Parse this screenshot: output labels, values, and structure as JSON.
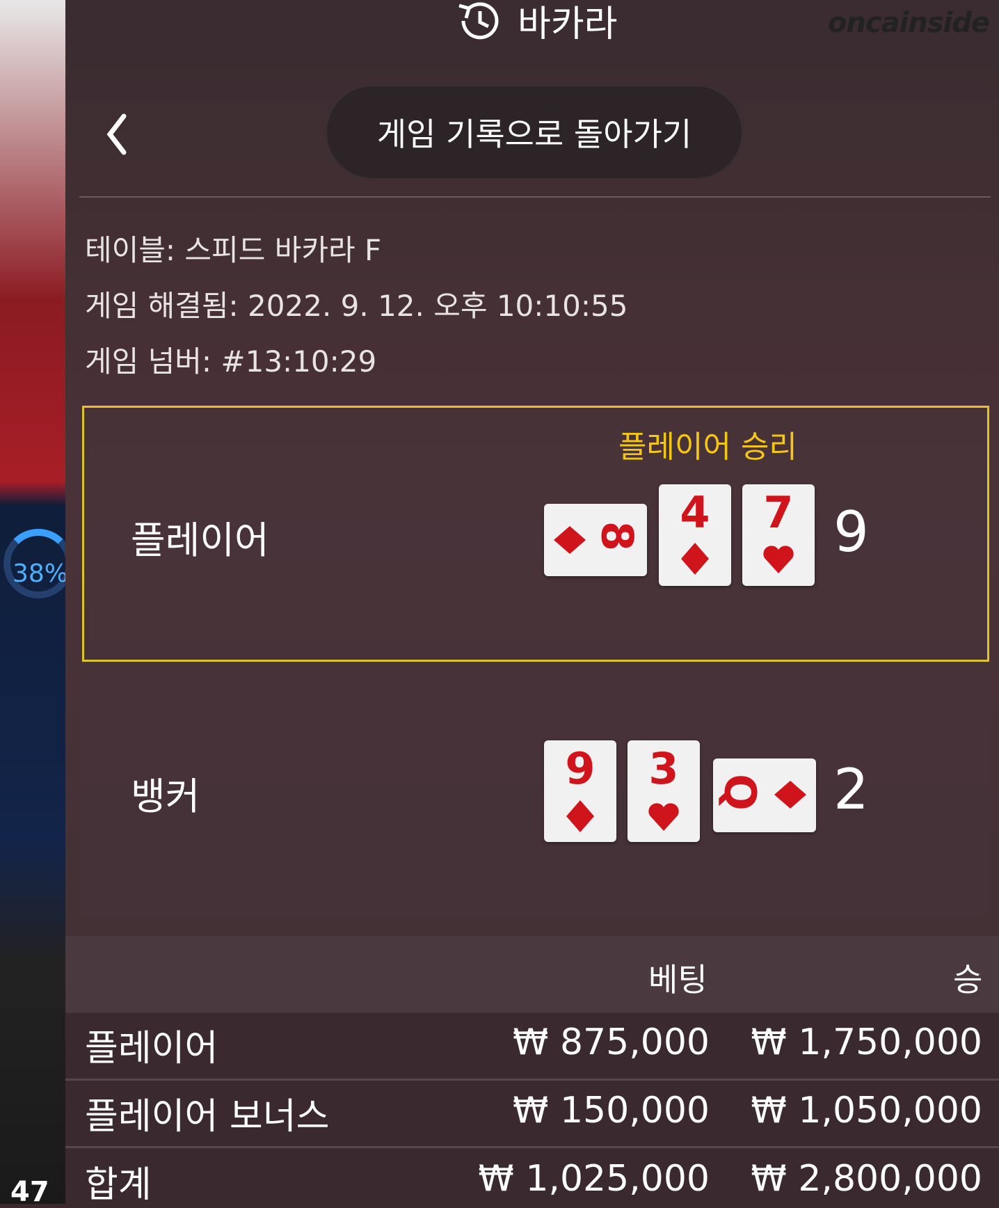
{
  "header": {
    "title": "바카라",
    "watermark": "oncainside"
  },
  "nav": {
    "back_label": "게임 기록으로 돌아가기"
  },
  "info": {
    "table": "테이블: 스피드 바카라 F",
    "resolved": "게임 해결됨: 2022. 9. 12. 오후 10:10:55",
    "number": "게임 넘버: #13:10:29"
  },
  "result": {
    "win_label": "플레이어 승리",
    "player": {
      "label": "플레이어",
      "score": "9",
      "cards": [
        {
          "rank": "8",
          "suit": "diamond",
          "sideways": true
        },
        {
          "rank": "4",
          "suit": "diamond"
        },
        {
          "rank": "7",
          "suit": "heart"
        }
      ]
    },
    "banker": {
      "label": "뱅커",
      "score": "2",
      "cards": [
        {
          "rank": "9",
          "suit": "diamond"
        },
        {
          "rank": "3",
          "suit": "heart"
        },
        {
          "rank": "Q",
          "suit": "diamond",
          "sideways": true
        }
      ]
    }
  },
  "bets": {
    "headers": {
      "bet": "베팅",
      "win": "승"
    },
    "rows": [
      {
        "name": "플레이어",
        "bet": "₩ 875,000",
        "win": "₩ 1,750,000"
      },
      {
        "name": "플레이어 보너스",
        "bet": "₩ 150,000",
        "win": "₩ 1,050,000"
      },
      {
        "name": "합계",
        "bet": "₩ 1,025,000",
        "win": "₩ 2,800,000"
      }
    ]
  },
  "background": {
    "percent": "38%",
    "number": "47"
  },
  "colors": {
    "accent": "#f5c518",
    "card_red": "#d0141c",
    "panel": "#3f3035"
  }
}
